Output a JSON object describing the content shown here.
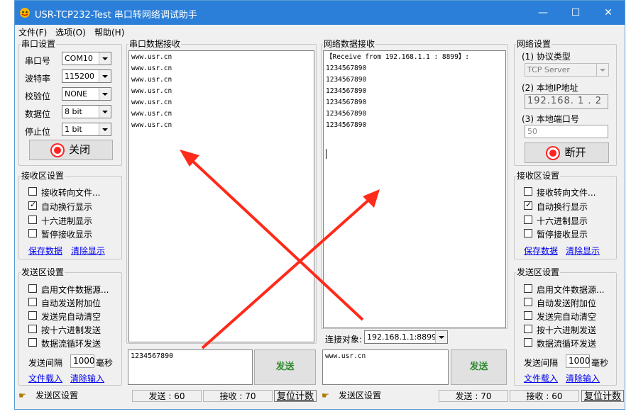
{
  "window": {
    "title": "USR-TCP232-Test 串口转网络调试助手",
    "min": "—",
    "max": "☐",
    "close": "✕"
  },
  "menu": [
    "文件(F)",
    "选项(O)",
    "帮助(H)"
  ],
  "serial_settings": {
    "title": "串口设置",
    "port_label": "串口号",
    "port_value": "COM10",
    "baud_label": "波特率",
    "baud_value": "115200",
    "parity_label": "校验位",
    "parity_value": "NONE",
    "data_label": "数据位",
    "data_value": "8 bit",
    "stop_label": "停止位",
    "stop_value": "1 bit",
    "close_button": "关闭"
  },
  "serial_recv_settings": {
    "title": "接收区设置",
    "options": [
      {
        "label": "接收转向文件...",
        "checked": false
      },
      {
        "label": "自动换行显示",
        "checked": true
      },
      {
        "label": "十六进制显示",
        "checked": false
      },
      {
        "label": "暂停接收显示",
        "checked": false
      }
    ],
    "save_link": "保存数据",
    "clear_link": "清除显示"
  },
  "serial_send_settings": {
    "title": "发送区设置",
    "options": [
      {
        "label": "启用文件数据源...",
        "checked": false
      },
      {
        "label": "自动发送附加位",
        "checked": false
      },
      {
        "label": "发送完自动清空",
        "checked": false
      },
      {
        "label": "按十六进制发送",
        "checked": false
      },
      {
        "label": "数据流循环发送",
        "checked": false
      }
    ],
    "interval_label": "发送间隔",
    "interval_value": "1000",
    "interval_unit": "毫秒",
    "load_link": "文件载入",
    "clear_link": "清除输入"
  },
  "serial_recv_pane": {
    "title": "串口数据接收",
    "lines": [
      "www.usr.cn",
      "www.usr.cn",
      "www.usr.cn",
      "www.usr.cn",
      "www.usr.cn",
      "www.usr.cn",
      "www.usr.cn"
    ]
  },
  "net_recv_pane": {
    "title": "网络数据接收",
    "lines": [
      "【Receive from 192.168.1.1 : 8899】:",
      "1234567890",
      "1234567890",
      "1234567890",
      "1234567890",
      "1234567890",
      "1234567890"
    ]
  },
  "net_settings": {
    "title": "网络设置",
    "proto_label": "(1) 协议类型",
    "proto_value": "TCP Server",
    "ip_label": "(2) 本地IP地址",
    "ip_value": "192.168. 1 . 2",
    "port_label": "(3) 本地端口号",
    "port_value": "50",
    "disconnect_button": "断开"
  },
  "net_recv_settings": {
    "title": "接收区设置",
    "options": [
      {
        "label": "接收转向文件...",
        "checked": false
      },
      {
        "label": "自动换行显示",
        "checked": true
      },
      {
        "label": "十六进制显示",
        "checked": false
      },
      {
        "label": "暂停接收显示",
        "checked": false
      }
    ],
    "save_link": "保存数据",
    "clear_link": "清除显示"
  },
  "net_send_settings": {
    "title": "发送区设置",
    "options": [
      {
        "label": "启用文件数据源...",
        "checked": false
      },
      {
        "label": "自动发送附加位",
        "checked": false
      },
      {
        "label": "发送完自动清空",
        "checked": false
      },
      {
        "label": "按十六进制发送",
        "checked": false
      },
      {
        "label": "数据流循环发送",
        "checked": false
      }
    ],
    "interval_label": "发送间隔",
    "interval_value": "1000",
    "interval_unit": "毫秒",
    "load_link": "文件载入",
    "clear_link": "清除输入"
  },
  "connect_target": {
    "label": "连接对象:",
    "value": "192.168.1.1:8899"
  },
  "serial_send": {
    "text": "1234567890",
    "button": "发送"
  },
  "net_send": {
    "text": "www.usr.cn",
    "button": "发送"
  },
  "status_left": {
    "label": "发送区设置",
    "sent": "发送 : 60",
    "recv": "接收 : 70",
    "reset": "复位计数"
  },
  "status_right": {
    "label": "发送区设置",
    "sent": "发送 : 70",
    "recv": "接收 : 60",
    "reset": "复位计数"
  },
  "colors": {
    "title_bar": "#2b7fd8",
    "arrow": "#ff2a1a",
    "send_text": "#2e8b2e",
    "link": "#0000ee"
  }
}
